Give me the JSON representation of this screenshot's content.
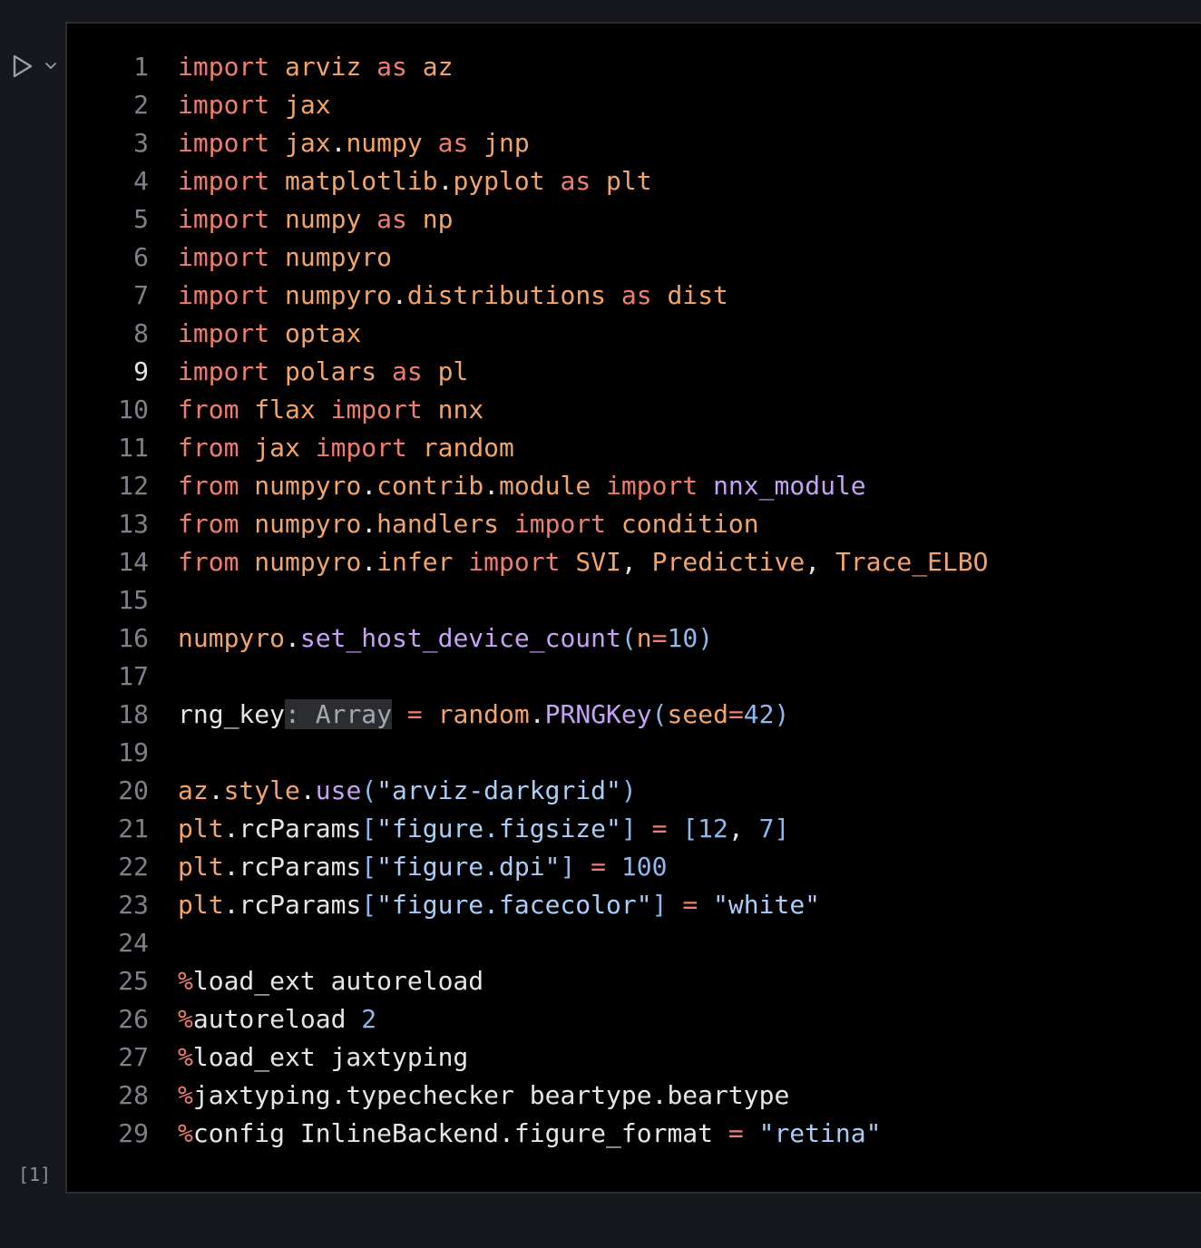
{
  "toolbar": {
    "run_icon": "play-icon",
    "menu_icon": "chevron-down-icon"
  },
  "cell": {
    "execution_count": "[1]",
    "active_line": 9,
    "lines": [
      {
        "n": "1",
        "tokens": [
          [
            "kw",
            "import"
          ],
          [
            "t",
            " "
          ],
          [
            "mod",
            "arviz"
          ],
          [
            "t",
            " "
          ],
          [
            "kw",
            "as"
          ],
          [
            "t",
            " "
          ],
          [
            "mod",
            "az"
          ]
        ]
      },
      {
        "n": "2",
        "tokens": [
          [
            "kw",
            "import"
          ],
          [
            "t",
            " "
          ],
          [
            "mod",
            "jax"
          ]
        ]
      },
      {
        "n": "3",
        "tokens": [
          [
            "kw",
            "import"
          ],
          [
            "t",
            " "
          ],
          [
            "mod",
            "jax"
          ],
          [
            "t",
            "."
          ],
          [
            "mod",
            "numpy"
          ],
          [
            "t",
            " "
          ],
          [
            "kw",
            "as"
          ],
          [
            "t",
            " "
          ],
          [
            "mod",
            "jnp"
          ]
        ]
      },
      {
        "n": "4",
        "tokens": [
          [
            "kw",
            "import"
          ],
          [
            "t",
            " "
          ],
          [
            "mod",
            "matplotlib"
          ],
          [
            "t",
            "."
          ],
          [
            "mod",
            "pyplot"
          ],
          [
            "t",
            " "
          ],
          [
            "kw",
            "as"
          ],
          [
            "t",
            " "
          ],
          [
            "mod",
            "plt"
          ]
        ]
      },
      {
        "n": "5",
        "tokens": [
          [
            "kw",
            "import"
          ],
          [
            "t",
            " "
          ],
          [
            "mod",
            "numpy"
          ],
          [
            "t",
            " "
          ],
          [
            "kw",
            "as"
          ],
          [
            "t",
            " "
          ],
          [
            "mod",
            "np"
          ]
        ]
      },
      {
        "n": "6",
        "tokens": [
          [
            "kw",
            "import"
          ],
          [
            "t",
            " "
          ],
          [
            "mod",
            "numpyro"
          ]
        ]
      },
      {
        "n": "7",
        "tokens": [
          [
            "kw",
            "import"
          ],
          [
            "t",
            " "
          ],
          [
            "mod",
            "numpyro"
          ],
          [
            "t",
            "."
          ],
          [
            "mod",
            "distributions"
          ],
          [
            "t",
            " "
          ],
          [
            "kw",
            "as"
          ],
          [
            "t",
            " "
          ],
          [
            "mod",
            "dist"
          ]
        ]
      },
      {
        "n": "8",
        "tokens": [
          [
            "kw",
            "import"
          ],
          [
            "t",
            " "
          ],
          [
            "mod",
            "optax"
          ]
        ]
      },
      {
        "n": "9",
        "tokens": [
          [
            "kw",
            "import"
          ],
          [
            "t",
            " "
          ],
          [
            "mod",
            "polars"
          ],
          [
            "t",
            " "
          ],
          [
            "kw",
            "as"
          ],
          [
            "t",
            " "
          ],
          [
            "mod",
            "pl"
          ]
        ]
      },
      {
        "n": "10",
        "tokens": [
          [
            "kw",
            "from"
          ],
          [
            "t",
            " "
          ],
          [
            "mod",
            "flax"
          ],
          [
            "t",
            " "
          ],
          [
            "kw",
            "import"
          ],
          [
            "t",
            " "
          ],
          [
            "mod",
            "nnx"
          ]
        ]
      },
      {
        "n": "11",
        "tokens": [
          [
            "kw",
            "from"
          ],
          [
            "t",
            " "
          ],
          [
            "mod",
            "jax"
          ],
          [
            "t",
            " "
          ],
          [
            "kw",
            "import"
          ],
          [
            "t",
            " "
          ],
          [
            "mod",
            "random"
          ]
        ]
      },
      {
        "n": "12",
        "tokens": [
          [
            "kw",
            "from"
          ],
          [
            "t",
            " "
          ],
          [
            "mod",
            "numpyro"
          ],
          [
            "t",
            "."
          ],
          [
            "mod",
            "contrib"
          ],
          [
            "t",
            "."
          ],
          [
            "mod",
            "module"
          ],
          [
            "t",
            " "
          ],
          [
            "kw",
            "import"
          ],
          [
            "t",
            " "
          ],
          [
            "fn",
            "nnx_module"
          ]
        ]
      },
      {
        "n": "13",
        "tokens": [
          [
            "kw",
            "from"
          ],
          [
            "t",
            " "
          ],
          [
            "mod",
            "numpyro"
          ],
          [
            "t",
            "."
          ],
          [
            "mod",
            "handlers"
          ],
          [
            "t",
            " "
          ],
          [
            "kw",
            "import"
          ],
          [
            "t",
            " "
          ],
          [
            "mod",
            "condition"
          ]
        ]
      },
      {
        "n": "14",
        "tokens": [
          [
            "kw",
            "from"
          ],
          [
            "t",
            " "
          ],
          [
            "mod",
            "numpyro"
          ],
          [
            "t",
            "."
          ],
          [
            "mod",
            "infer"
          ],
          [
            "t",
            " "
          ],
          [
            "kw",
            "import"
          ],
          [
            "t",
            " "
          ],
          [
            "mod",
            "SVI"
          ],
          [
            "t",
            ", "
          ],
          [
            "mod",
            "Predictive"
          ],
          [
            "t",
            ", "
          ],
          [
            "mod",
            "Trace_ELBO"
          ]
        ]
      },
      {
        "n": "15",
        "tokens": []
      },
      {
        "n": "16",
        "tokens": [
          [
            "mod",
            "numpyro"
          ],
          [
            "t",
            "."
          ],
          [
            "fn",
            "set_host_device_count"
          ],
          [
            "pn",
            "("
          ],
          [
            "mod",
            "n"
          ],
          [
            "kw",
            "="
          ],
          [
            "num",
            "10"
          ],
          [
            "pn",
            ")"
          ]
        ]
      },
      {
        "n": "17",
        "tokens": []
      },
      {
        "n": "18",
        "tokens": [
          [
            "t",
            "rng_key"
          ],
          [
            "hint",
            ": Array"
          ],
          [
            "t",
            " "
          ],
          [
            "kw",
            "="
          ],
          [
            "t",
            " "
          ],
          [
            "mod",
            "random"
          ],
          [
            "t",
            "."
          ],
          [
            "fn",
            "PRNGKey"
          ],
          [
            "pn",
            "("
          ],
          [
            "mod",
            "seed"
          ],
          [
            "kw",
            "="
          ],
          [
            "num",
            "42"
          ],
          [
            "pn",
            ")"
          ]
        ]
      },
      {
        "n": "19",
        "tokens": []
      },
      {
        "n": "20",
        "tokens": [
          [
            "mod",
            "az"
          ],
          [
            "t",
            "."
          ],
          [
            "mod",
            "style"
          ],
          [
            "t",
            "."
          ],
          [
            "fn",
            "use"
          ],
          [
            "pn",
            "("
          ],
          [
            "str",
            "\"arviz-darkgrid\""
          ],
          [
            "pn",
            ")"
          ]
        ]
      },
      {
        "n": "21",
        "tokens": [
          [
            "mod",
            "plt"
          ],
          [
            "t",
            ".rcParams"
          ],
          [
            "pn",
            "["
          ],
          [
            "str",
            "\"figure.figsize\""
          ],
          [
            "pn",
            "]"
          ],
          [
            "t",
            " "
          ],
          [
            "kw",
            "="
          ],
          [
            "t",
            " "
          ],
          [
            "pn",
            "["
          ],
          [
            "num",
            "12"
          ],
          [
            "t",
            ", "
          ],
          [
            "num",
            "7"
          ],
          [
            "pn",
            "]"
          ]
        ]
      },
      {
        "n": "22",
        "tokens": [
          [
            "mod",
            "plt"
          ],
          [
            "t",
            ".rcParams"
          ],
          [
            "pn",
            "["
          ],
          [
            "str",
            "\"figure.dpi\""
          ],
          [
            "pn",
            "]"
          ],
          [
            "t",
            " "
          ],
          [
            "kw",
            "="
          ],
          [
            "t",
            " "
          ],
          [
            "num",
            "100"
          ]
        ]
      },
      {
        "n": "23",
        "tokens": [
          [
            "mod",
            "plt"
          ],
          [
            "t",
            ".rcParams"
          ],
          [
            "pn",
            "["
          ],
          [
            "str",
            "\"figure.facecolor\""
          ],
          [
            "pn",
            "]"
          ],
          [
            "t",
            " "
          ],
          [
            "kw",
            "="
          ],
          [
            "t",
            " "
          ],
          [
            "str",
            "\"white\""
          ]
        ]
      },
      {
        "n": "24",
        "tokens": []
      },
      {
        "n": "25",
        "tokens": [
          [
            "pct",
            "%"
          ],
          [
            "t",
            "load_ext autoreload"
          ]
        ]
      },
      {
        "n": "26",
        "tokens": [
          [
            "pct",
            "%"
          ],
          [
            "t",
            "autoreload "
          ],
          [
            "num",
            "2"
          ]
        ]
      },
      {
        "n": "27",
        "tokens": [
          [
            "pct",
            "%"
          ],
          [
            "t",
            "load_ext jaxtyping"
          ]
        ]
      },
      {
        "n": "28",
        "tokens": [
          [
            "pct",
            "%"
          ],
          [
            "t",
            "jaxtyping.typechecker beartype.beartype"
          ]
        ]
      },
      {
        "n": "29",
        "tokens": [
          [
            "pct",
            "%"
          ],
          [
            "t",
            "config InlineBackend.figure_format "
          ],
          [
            "kw",
            "="
          ],
          [
            "t",
            " "
          ],
          [
            "str",
            "\"retina\""
          ]
        ]
      }
    ]
  }
}
